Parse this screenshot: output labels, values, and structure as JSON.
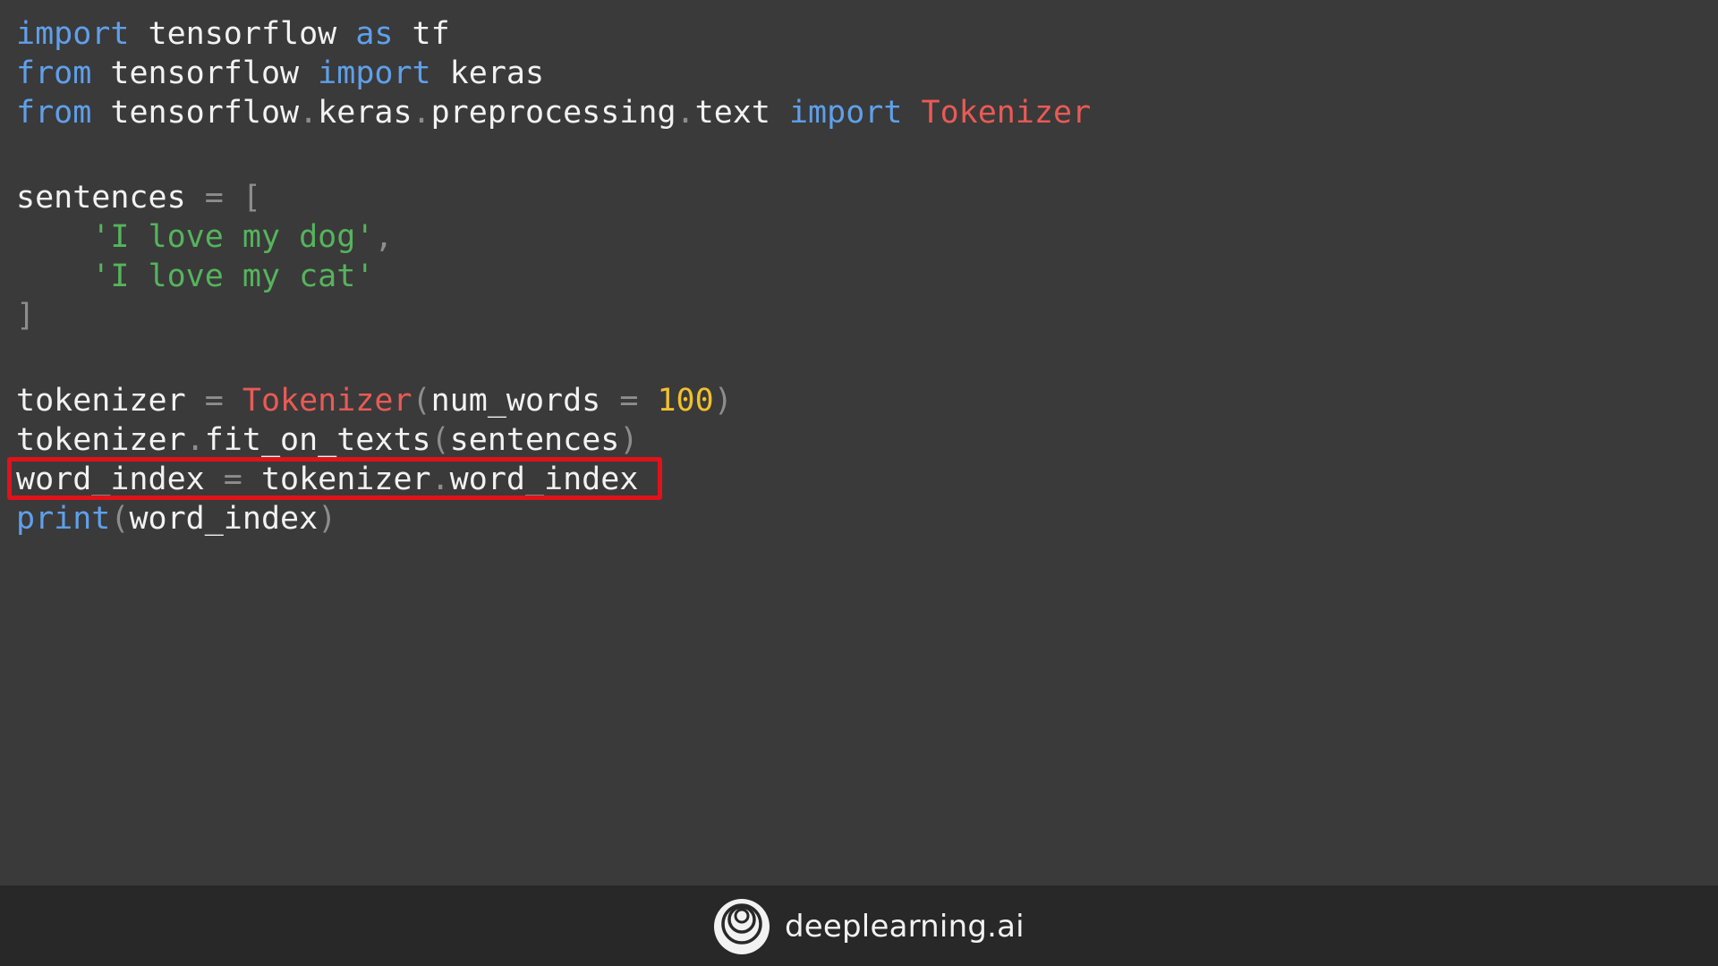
{
  "code_lines": [
    [
      [
        "kw",
        "import"
      ],
      [
        "plain",
        " tensorflow "
      ],
      [
        "kw",
        "as"
      ],
      [
        "plain",
        " tf"
      ]
    ],
    [
      [
        "kw",
        "from"
      ],
      [
        "plain",
        " tensorflow "
      ],
      [
        "kw",
        "import"
      ],
      [
        "plain",
        " keras"
      ]
    ],
    [
      [
        "kw",
        "from"
      ],
      [
        "plain",
        " tensorflow"
      ],
      [
        "op",
        "."
      ],
      [
        "plain",
        "keras"
      ],
      [
        "op",
        "."
      ],
      [
        "plain",
        "preprocessing"
      ],
      [
        "op",
        "."
      ],
      [
        "plain",
        "text "
      ],
      [
        "kw",
        "import"
      ],
      [
        "plain",
        " "
      ],
      [
        "cls",
        "Tokenizer"
      ]
    ],
    [],
    [
      [
        "plain",
        "sentences "
      ],
      [
        "op",
        "="
      ],
      [
        "plain",
        " "
      ],
      [
        "op",
        "["
      ]
    ],
    [
      [
        "plain",
        "    "
      ],
      [
        "str",
        "'I love my dog'"
      ],
      [
        "op",
        ","
      ]
    ],
    [
      [
        "plain",
        "    "
      ],
      [
        "str",
        "'I love my cat'"
      ]
    ],
    [
      [
        "op",
        "]"
      ]
    ],
    [],
    [
      [
        "plain",
        "tokenizer "
      ],
      [
        "op",
        "="
      ],
      [
        "plain",
        " "
      ],
      [
        "cls",
        "Tokenizer"
      ],
      [
        "op",
        "("
      ],
      [
        "plain",
        "num_words "
      ],
      [
        "op",
        "="
      ],
      [
        "plain",
        " "
      ],
      [
        "num",
        "100"
      ],
      [
        "op",
        ")"
      ]
    ],
    [
      [
        "plain",
        "tokenizer"
      ],
      [
        "op",
        "."
      ],
      [
        "plain",
        "fit_on_texts"
      ],
      [
        "op",
        "("
      ],
      [
        "plain",
        "sentences"
      ],
      [
        "op",
        ")"
      ]
    ],
    [
      [
        "plain",
        "word_index "
      ],
      [
        "op",
        "="
      ],
      [
        "plain",
        " tokenizer"
      ],
      [
        "op",
        "."
      ],
      [
        "plain",
        "word_index"
      ]
    ],
    [
      [
        "kw",
        "print"
      ],
      [
        "op",
        "("
      ],
      [
        "plain",
        "word_index"
      ],
      [
        "op",
        ")"
      ]
    ]
  ],
  "highlighted_line": 11,
  "colors": {
    "background": "#3a3a3a",
    "footer": "#282828",
    "keyword": "#5fa0ea",
    "class_name": "#ea5a55",
    "string": "#55b45c",
    "number": "#f0c030",
    "operator": "#8d8d8d",
    "text": "#f2f2f2",
    "highlight_border": "#e0121a"
  },
  "footer": {
    "logo_icon": "deeplearning-ai-logo-icon",
    "brand_text": "deeplearning.ai"
  }
}
